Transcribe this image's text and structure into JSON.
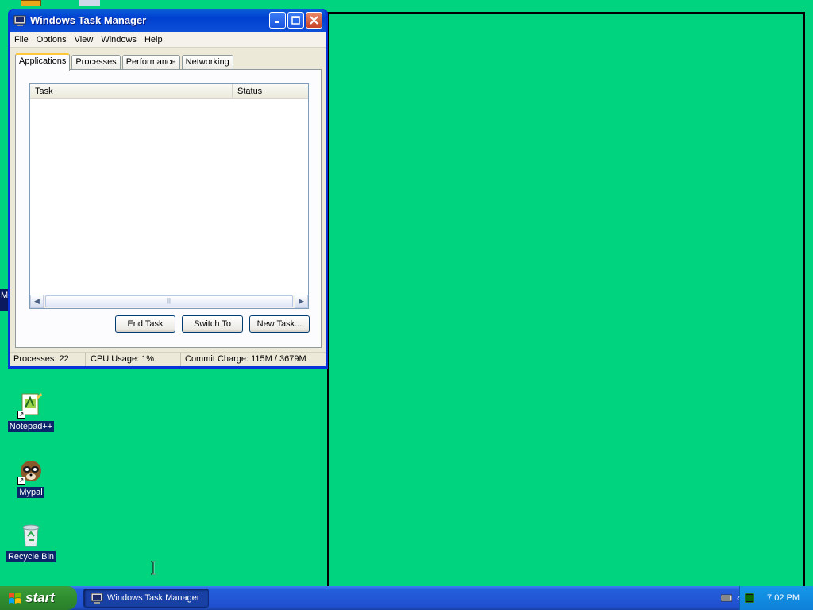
{
  "window": {
    "title": "Windows Task Manager",
    "menu": [
      "File",
      "Options",
      "View",
      "Windows",
      "Help"
    ],
    "tabs": [
      "Applications",
      "Processes",
      "Performance",
      "Networking"
    ],
    "active_tab": "Applications",
    "columns": {
      "task": "Task",
      "status": "Status"
    },
    "buttons": {
      "end_task": "End Task",
      "switch_to": "Switch To",
      "new_task": "New Task..."
    },
    "status": {
      "processes": "Processes: 22",
      "cpu": "CPU Usage: 1%",
      "commit": "Commit Charge: 115M / 3679M"
    }
  },
  "desktop": {
    "icons": [
      {
        "label": "Notepad++",
        "icon": "notepadpp-icon"
      },
      {
        "label": "Mypal",
        "icon": "mypal-icon"
      },
      {
        "label": "Recycle Bin",
        "icon": "recycle-bin-icon"
      }
    ],
    "left_stub_text": "M"
  },
  "taskbar": {
    "start_label": "start",
    "task_button": "Windows Task Manager",
    "clock": "7:02 PM"
  },
  "colors": {
    "desktop": "#00d47f",
    "title_blue": "#0040d0",
    "start_green": "#2f8d2f"
  }
}
